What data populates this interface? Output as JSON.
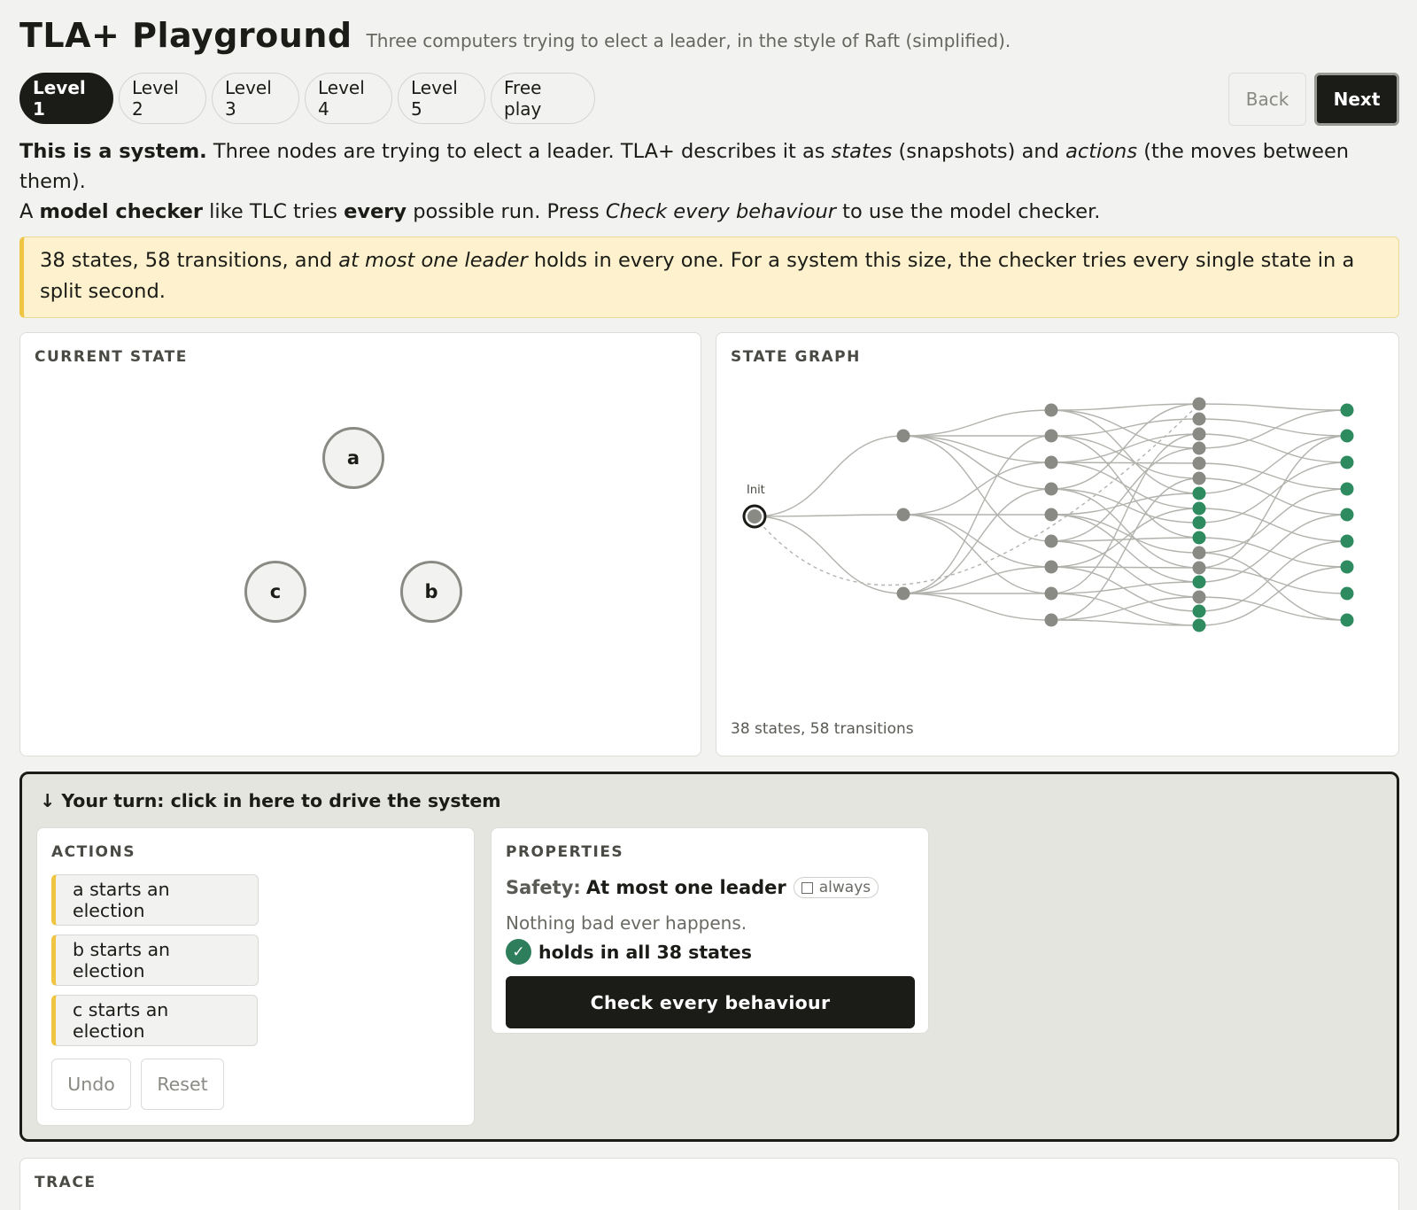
{
  "app": {
    "title": "TLA+ Playground",
    "subtitle": "Three computers trying to elect a leader, in the style of Raft (simplified)."
  },
  "levels": [
    "Level 1",
    "Level 2",
    "Level 3",
    "Level 4",
    "Level 5",
    "Free play"
  ],
  "active_level": "Level 1",
  "nav": {
    "back": "Back",
    "next": "Next"
  },
  "intro": {
    "p1_bold": "This is a system.",
    "p1_a": " Three nodes are trying to elect a leader. TLA+ describes it as ",
    "p1_states": "states",
    "p1_b": " (snapshots) and ",
    "p1_actions": "actions",
    "p1_c": " (the moves between them).",
    "p2_a": "A ",
    "p2_mc": "model checker",
    "p2_b": " like TLC tries ",
    "p2_every": "every",
    "p2_c": " possible run. Press ",
    "p2_check": "Check every behaviour",
    "p2_d": " to use the model checker."
  },
  "callout": {
    "a": "38 states, 58 transitions, and ",
    "em": "at most one leader",
    "b": " holds in every one. For a system this size, the checker tries every single state in a split second."
  },
  "current_state": {
    "label": "CURRENT STATE",
    "nodes": [
      "a",
      "b",
      "c"
    ]
  },
  "state_graph": {
    "label": "STATE GRAPH",
    "init_label": "Init",
    "footer": "38 states, 58 transitions",
    "node_color": "#8a8a84",
    "good_color": "#2e8b5f"
  },
  "turn": {
    "title": "↓ Your turn: click in here to drive the system",
    "actions_label": "ACTIONS",
    "actions": [
      "a starts an election",
      "b starts an election",
      "c starts an election"
    ],
    "undo": "Undo",
    "reset": "Reset",
    "properties_label": "PROPERTIES",
    "safety_label": "Safety:",
    "safety_name": "At most one leader",
    "always": "always",
    "description": "Nothing bad ever happens.",
    "holds": "holds in all 38 states",
    "check_button": "Check every behaviour"
  },
  "trace": {
    "label": "TRACE"
  },
  "colors": {
    "accent": "#1b1b17",
    "callout_bg": "#fdf2cd",
    "action_stripe": "#f0c542",
    "ok_green": "#2e7d5b"
  }
}
